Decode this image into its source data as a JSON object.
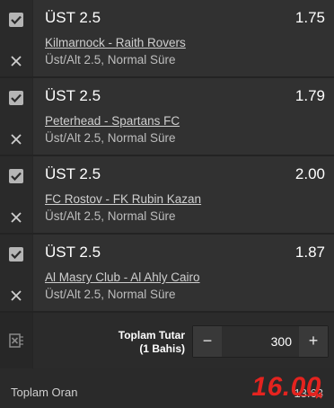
{
  "bets": [
    {
      "selection": "ÜST 2.5",
      "odd": "1.75",
      "match": "Kilmarnock - Raith Rovers",
      "market": "Üst/Alt 2.5, Normal Süre"
    },
    {
      "selection": "ÜST 2.5",
      "odd": "1.79",
      "match": "Peterhead - Spartans FC",
      "market": "Üst/Alt 2.5, Normal Süre"
    },
    {
      "selection": "ÜST 2.5",
      "odd": "2.00",
      "match": "FC Rostov - FK Rubin Kazan",
      "market": "Üst/Alt 2.5, Normal Süre"
    },
    {
      "selection": "ÜST 2.5",
      "odd": "1.87",
      "match": "Al Masry Club - Al Ahly Cairo",
      "market": "Üst/Alt 2.5, Normal Süre"
    }
  ],
  "stake": {
    "label_line1": "Toplam Tutar",
    "label_line2": "(1 Bahis)",
    "minus": "−",
    "plus": "+",
    "amount": "300"
  },
  "total": {
    "label": "Toplam Oran",
    "old_odds": "13.63",
    "new_odds": "16.00"
  },
  "colors": {
    "accent_red": "#e4231f",
    "checkbox": "#b5b5b5"
  }
}
